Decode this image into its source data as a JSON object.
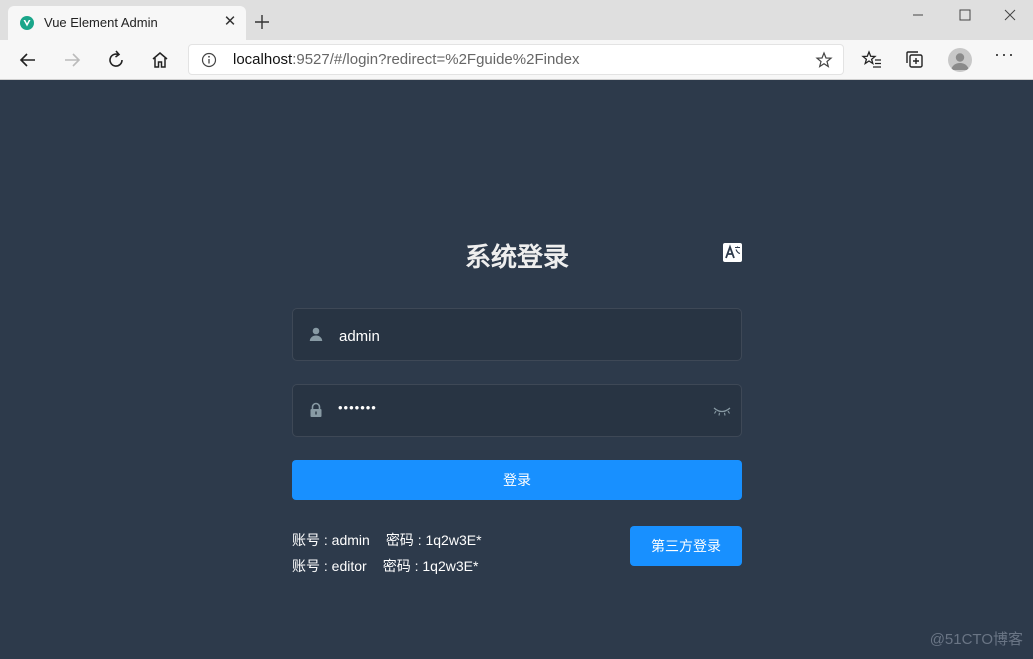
{
  "browser": {
    "tab_title": "Vue Element Admin",
    "address_host": "localhost",
    "address_rest": ":9527/#/login?redirect=%2Fguide%2Findex",
    "colors": {
      "tabstrip": "#dfdfdf",
      "toolbar": "#f7f7f7"
    }
  },
  "login": {
    "title": "系统登录",
    "username_value": "admin",
    "password_mask": "•••••••",
    "login_button": "登录",
    "tips": [
      {
        "account_label": "账号 : admin",
        "password_label": "密码 : 1q2w3E*"
      },
      {
        "account_label": "账号 : editor",
        "password_label": "密码 : 1q2w3E*"
      }
    ],
    "third_party_button": "第三方登录",
    "colors": {
      "background": "#2d3a4b",
      "primary": "#1890ff"
    }
  },
  "watermark": "@51CTO博客",
  "icons": {
    "favicon": "vue-logo-icon",
    "close": "close-icon",
    "new_tab": "plus-icon",
    "back": "back-arrow-icon",
    "forward": "forward-arrow-icon",
    "refresh": "refresh-icon",
    "home": "home-icon",
    "info": "info-icon",
    "favorite": "star-icon",
    "favorites": "favorites-icon",
    "collections": "collections-icon",
    "profile": "avatar",
    "menu": "more-icon",
    "user": "user-icon",
    "lock": "lock-icon",
    "eye": "eye-closed-icon",
    "lang": "translate-icon"
  }
}
